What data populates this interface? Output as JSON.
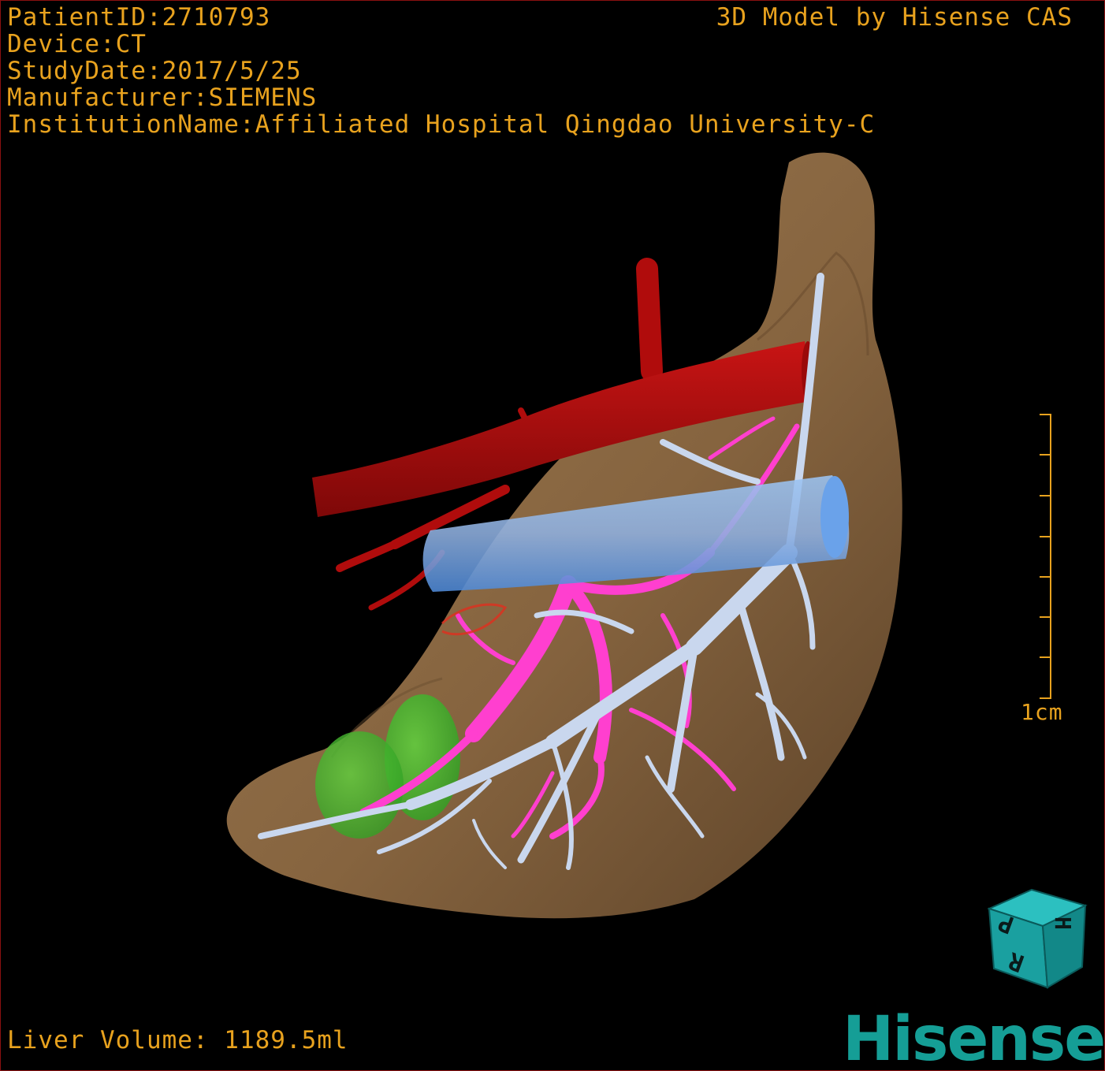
{
  "viewer": {
    "patient_id_label": "PatientID:2710793",
    "device_label": "Device:CT",
    "study_date_label": "StudyDate:2017/5/25",
    "manufacturer_label": "Manufacturer:SIEMENS",
    "institution_label": "InstitutionName:Affiliated Hospital Qingdao University-C",
    "credit_label": "3D Model by Hisense CAS",
    "liver_volume_label": "Liver Volume: 1189.5ml",
    "scale_label": "1cm",
    "brand": "Hisense"
  },
  "orientation_cube": {
    "face_letters": [
      "P",
      "H",
      "R"
    ],
    "color": "#1aa0a0"
  },
  "colors": {
    "overlay_text": "#e8a21e",
    "liver": "#8a6a45",
    "artery": "#b00c0c",
    "portal_vein": "#ff40d0",
    "hepatic_vein": "#c7d6ee",
    "vena_cava": "#6aa6ea",
    "lesion": "#3fbf2a",
    "brand": "#159e96"
  }
}
